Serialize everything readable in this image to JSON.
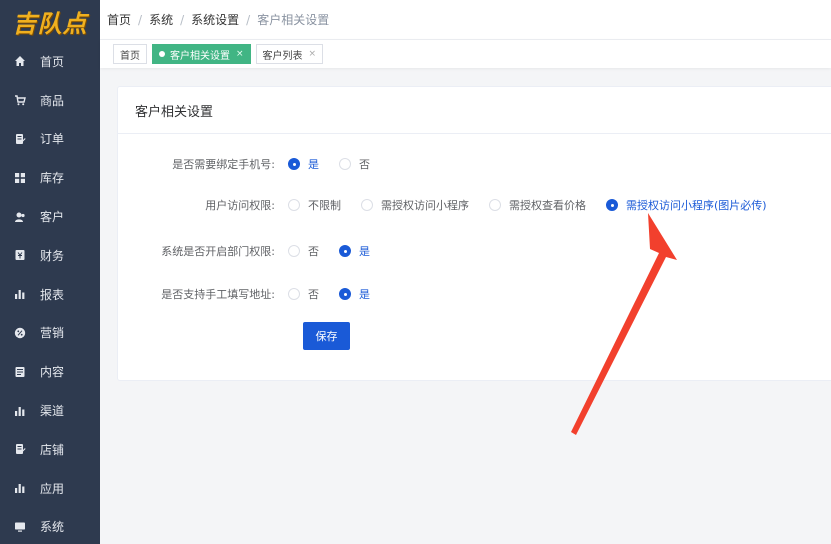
{
  "brand": {
    "logo_text": "吉队点",
    "logo_color": "#f0b01f"
  },
  "sidebar": {
    "items": [
      {
        "label": "首页",
        "icon": "home-icon"
      },
      {
        "label": "商品",
        "icon": "cart-icon"
      },
      {
        "label": "订单",
        "icon": "order-icon"
      },
      {
        "label": "库存",
        "icon": "grid-icon"
      },
      {
        "label": "客户",
        "icon": "user-icon"
      },
      {
        "label": "财务",
        "icon": "finance-icon"
      },
      {
        "label": "报表",
        "icon": "bar-chart-icon"
      },
      {
        "label": "营销",
        "icon": "percent-icon"
      },
      {
        "label": "内容",
        "icon": "document-icon"
      },
      {
        "label": "渠道",
        "icon": "bar-chart-icon"
      },
      {
        "label": "店铺",
        "icon": "store-icon"
      },
      {
        "label": "应用",
        "icon": "bar-chart-icon"
      },
      {
        "label": "系统",
        "icon": "monitor-icon"
      }
    ]
  },
  "breadcrumb": {
    "items": [
      "首页",
      "系统",
      "系统设置",
      "客户相关设置"
    ],
    "separator": "/"
  },
  "tabs": [
    {
      "label": "首页",
      "active": false,
      "closable": false
    },
    {
      "label": "客户相关设置",
      "active": true,
      "closable": true
    },
    {
      "label": "客户列表",
      "active": false,
      "closable": true
    }
  ],
  "tab_close_glyph": "×",
  "card": {
    "title": "客户相关设置",
    "fields": [
      {
        "label": "是否需要绑定手机号:",
        "options": [
          {
            "label": "是",
            "checked": true
          },
          {
            "label": "否",
            "checked": false
          }
        ]
      },
      {
        "label": "用户访问权限:",
        "options": [
          {
            "label": "不限制",
            "checked": false
          },
          {
            "label": "需授权访问小程序",
            "checked": false
          },
          {
            "label": "需授权查看价格",
            "checked": false
          },
          {
            "label": "需授权访问小程序(图片必传)",
            "checked": true
          }
        ]
      },
      {
        "label": "系统是否开启部门权限:",
        "options": [
          {
            "label": "否",
            "checked": false
          },
          {
            "label": "是",
            "checked": true
          }
        ]
      },
      {
        "label": "是否支持手工填写地址:",
        "options": [
          {
            "label": "否",
            "checked": false
          },
          {
            "label": "是",
            "checked": true
          }
        ]
      }
    ],
    "save_label": "保存"
  },
  "colors": {
    "sidebar_bg": "#2e3a4f",
    "primary": "#1a5ad7",
    "active_tab": "#41b584",
    "annotation_arrow": "#f2402d"
  }
}
